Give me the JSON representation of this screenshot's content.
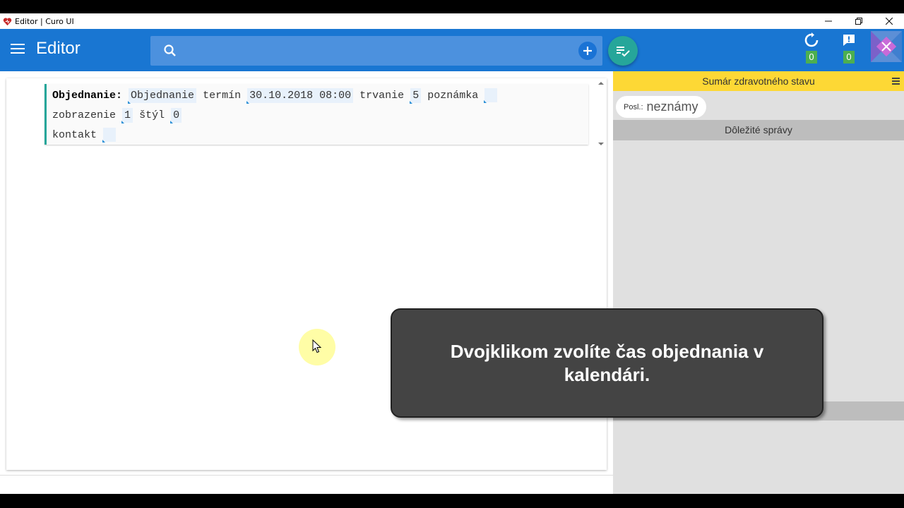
{
  "window": {
    "title": "Editor | Curo UI",
    "controls": [
      "minimize",
      "restore",
      "close"
    ]
  },
  "appbar": {
    "title": "Editor",
    "search_placeholder": "",
    "sync_badge": "0",
    "messages_badge": "0"
  },
  "form": {
    "label": "Objednanie:",
    "type_value": "Objednanie",
    "term_label": "termín",
    "term_value": "30.10.2018 08:00",
    "duration_label": "trvanie",
    "duration_value": "5",
    "note_label": "poznámka",
    "display_label": "zobrazenie",
    "display_value": "1",
    "style_label": "štýl",
    "style_value": "0",
    "contact_label": "kontakt"
  },
  "right_panel": {
    "summary_title": "Sumár zdravotného stavu",
    "posl_label": "Posl.:",
    "posl_value": "neznámy",
    "messages_title": "Dôležité správy"
  },
  "tooltip": {
    "text": "Dvojklikom zvolíte čas objednania v kalendári."
  },
  "colors": {
    "appbar": "#1976d2",
    "fab": "#26a69a",
    "summary_header": "#fdd835",
    "badge": "#4caf50"
  }
}
